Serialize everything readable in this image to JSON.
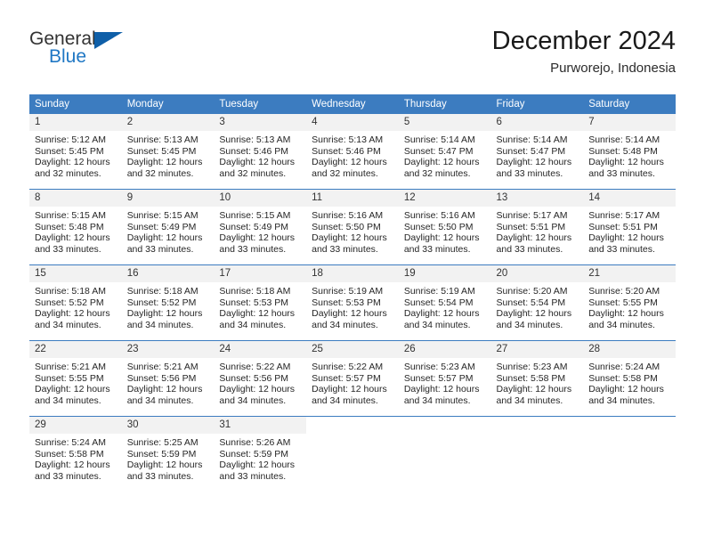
{
  "brand": {
    "word_one": "General",
    "word_two": "Blue",
    "triangle_icon": "triangle-icon",
    "colors": {
      "blue_text": "#1f77c4",
      "triangle": "#0f5fa8",
      "dark_text": "#333333"
    }
  },
  "header": {
    "month_title": "December 2024",
    "location": "Purworejo, Indonesia"
  },
  "theme": {
    "header_blue": "#3c7cc0",
    "daynum_band": "#f2f2f2",
    "row_rule": "#3c7cc0"
  },
  "calendar": {
    "weekdays": [
      "Sunday",
      "Monday",
      "Tuesday",
      "Wednesday",
      "Thursday",
      "Friday",
      "Saturday"
    ],
    "weeks": [
      [
        {
          "day": "1",
          "sunrise": "Sunrise: 5:12 AM",
          "sunset": "Sunset: 5:45 PM",
          "daylight": "Daylight: 12 hours and 32 minutes."
        },
        {
          "day": "2",
          "sunrise": "Sunrise: 5:13 AM",
          "sunset": "Sunset: 5:45 PM",
          "daylight": "Daylight: 12 hours and 32 minutes."
        },
        {
          "day": "3",
          "sunrise": "Sunrise: 5:13 AM",
          "sunset": "Sunset: 5:46 PM",
          "daylight": "Daylight: 12 hours and 32 minutes."
        },
        {
          "day": "4",
          "sunrise": "Sunrise: 5:13 AM",
          "sunset": "Sunset: 5:46 PM",
          "daylight": "Daylight: 12 hours and 32 minutes."
        },
        {
          "day": "5",
          "sunrise": "Sunrise: 5:14 AM",
          "sunset": "Sunset: 5:47 PM",
          "daylight": "Daylight: 12 hours and 32 minutes."
        },
        {
          "day": "6",
          "sunrise": "Sunrise: 5:14 AM",
          "sunset": "Sunset: 5:47 PM",
          "daylight": "Daylight: 12 hours and 33 minutes."
        },
        {
          "day": "7",
          "sunrise": "Sunrise: 5:14 AM",
          "sunset": "Sunset: 5:48 PM",
          "daylight": "Daylight: 12 hours and 33 minutes."
        }
      ],
      [
        {
          "day": "8",
          "sunrise": "Sunrise: 5:15 AM",
          "sunset": "Sunset: 5:48 PM",
          "daylight": "Daylight: 12 hours and 33 minutes."
        },
        {
          "day": "9",
          "sunrise": "Sunrise: 5:15 AM",
          "sunset": "Sunset: 5:49 PM",
          "daylight": "Daylight: 12 hours and 33 minutes."
        },
        {
          "day": "10",
          "sunrise": "Sunrise: 5:15 AM",
          "sunset": "Sunset: 5:49 PM",
          "daylight": "Daylight: 12 hours and 33 minutes."
        },
        {
          "day": "11",
          "sunrise": "Sunrise: 5:16 AM",
          "sunset": "Sunset: 5:50 PM",
          "daylight": "Daylight: 12 hours and 33 minutes."
        },
        {
          "day": "12",
          "sunrise": "Sunrise: 5:16 AM",
          "sunset": "Sunset: 5:50 PM",
          "daylight": "Daylight: 12 hours and 33 minutes."
        },
        {
          "day": "13",
          "sunrise": "Sunrise: 5:17 AM",
          "sunset": "Sunset: 5:51 PM",
          "daylight": "Daylight: 12 hours and 33 minutes."
        },
        {
          "day": "14",
          "sunrise": "Sunrise: 5:17 AM",
          "sunset": "Sunset: 5:51 PM",
          "daylight": "Daylight: 12 hours and 33 minutes."
        }
      ],
      [
        {
          "day": "15",
          "sunrise": "Sunrise: 5:18 AM",
          "sunset": "Sunset: 5:52 PM",
          "daylight": "Daylight: 12 hours and 34 minutes."
        },
        {
          "day": "16",
          "sunrise": "Sunrise: 5:18 AM",
          "sunset": "Sunset: 5:52 PM",
          "daylight": "Daylight: 12 hours and 34 minutes."
        },
        {
          "day": "17",
          "sunrise": "Sunrise: 5:18 AM",
          "sunset": "Sunset: 5:53 PM",
          "daylight": "Daylight: 12 hours and 34 minutes."
        },
        {
          "day": "18",
          "sunrise": "Sunrise: 5:19 AM",
          "sunset": "Sunset: 5:53 PM",
          "daylight": "Daylight: 12 hours and 34 minutes."
        },
        {
          "day": "19",
          "sunrise": "Sunrise: 5:19 AM",
          "sunset": "Sunset: 5:54 PM",
          "daylight": "Daylight: 12 hours and 34 minutes."
        },
        {
          "day": "20",
          "sunrise": "Sunrise: 5:20 AM",
          "sunset": "Sunset: 5:54 PM",
          "daylight": "Daylight: 12 hours and 34 minutes."
        },
        {
          "day": "21",
          "sunrise": "Sunrise: 5:20 AM",
          "sunset": "Sunset: 5:55 PM",
          "daylight": "Daylight: 12 hours and 34 minutes."
        }
      ],
      [
        {
          "day": "22",
          "sunrise": "Sunrise: 5:21 AM",
          "sunset": "Sunset: 5:55 PM",
          "daylight": "Daylight: 12 hours and 34 minutes."
        },
        {
          "day": "23",
          "sunrise": "Sunrise: 5:21 AM",
          "sunset": "Sunset: 5:56 PM",
          "daylight": "Daylight: 12 hours and 34 minutes."
        },
        {
          "day": "24",
          "sunrise": "Sunrise: 5:22 AM",
          "sunset": "Sunset: 5:56 PM",
          "daylight": "Daylight: 12 hours and 34 minutes."
        },
        {
          "day": "25",
          "sunrise": "Sunrise: 5:22 AM",
          "sunset": "Sunset: 5:57 PM",
          "daylight": "Daylight: 12 hours and 34 minutes."
        },
        {
          "day": "26",
          "sunrise": "Sunrise: 5:23 AM",
          "sunset": "Sunset: 5:57 PM",
          "daylight": "Daylight: 12 hours and 34 minutes."
        },
        {
          "day": "27",
          "sunrise": "Sunrise: 5:23 AM",
          "sunset": "Sunset: 5:58 PM",
          "daylight": "Daylight: 12 hours and 34 minutes."
        },
        {
          "day": "28",
          "sunrise": "Sunrise: 5:24 AM",
          "sunset": "Sunset: 5:58 PM",
          "daylight": "Daylight: 12 hours and 34 minutes."
        }
      ],
      [
        {
          "day": "29",
          "sunrise": "Sunrise: 5:24 AM",
          "sunset": "Sunset: 5:58 PM",
          "daylight": "Daylight: 12 hours and 33 minutes."
        },
        {
          "day": "30",
          "sunrise": "Sunrise: 5:25 AM",
          "sunset": "Sunset: 5:59 PM",
          "daylight": "Daylight: 12 hours and 33 minutes."
        },
        {
          "day": "31",
          "sunrise": "Sunrise: 5:26 AM",
          "sunset": "Sunset: 5:59 PM",
          "daylight": "Daylight: 12 hours and 33 minutes."
        },
        {
          "day": "",
          "sunrise": "",
          "sunset": "",
          "daylight": ""
        },
        {
          "day": "",
          "sunrise": "",
          "sunset": "",
          "daylight": ""
        },
        {
          "day": "",
          "sunrise": "",
          "sunset": "",
          "daylight": ""
        },
        {
          "day": "",
          "sunrise": "",
          "sunset": "",
          "daylight": ""
        }
      ]
    ]
  }
}
